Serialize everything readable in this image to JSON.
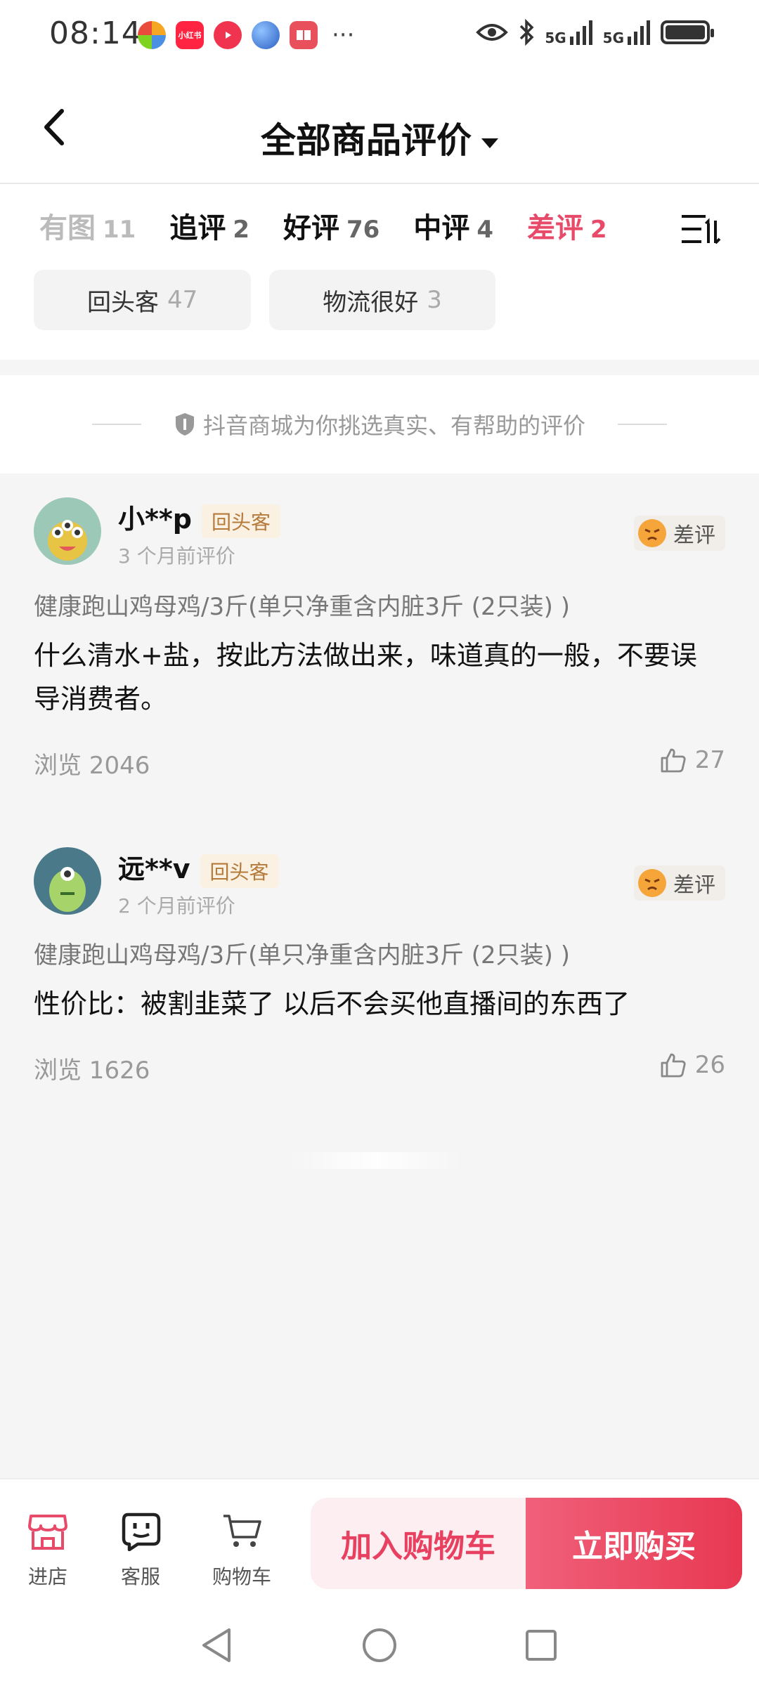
{
  "status_bar": {
    "time": "08:14",
    "apps": [
      {
        "icon": "app-pinwheel-icon",
        "color": "#4a90e2"
      },
      {
        "icon": "xiaohongshu-icon",
        "label": "小红书",
        "color": "#ff2442"
      },
      {
        "icon": "video-app-icon",
        "color": "#f0344f"
      },
      {
        "icon": "browser-app-icon",
        "color": "#3a7bd5"
      },
      {
        "icon": "reader-app-icon",
        "color": "#e8505b"
      }
    ],
    "more": "···",
    "network_1": "5G",
    "network_2": "5G"
  },
  "header": {
    "title": "全部商品评价"
  },
  "tabs": [
    {
      "label": "有图",
      "count": "11",
      "state": "faded"
    },
    {
      "label": "追评",
      "count": "2",
      "state": "normal"
    },
    {
      "label": "好评",
      "count": "76",
      "state": "normal"
    },
    {
      "label": "中评",
      "count": "4",
      "state": "normal"
    },
    {
      "label": "差评",
      "count": "2",
      "state": "active"
    }
  ],
  "chips": [
    {
      "label": "回头客",
      "count": "47"
    },
    {
      "label": "物流很好",
      "count": "3"
    }
  ],
  "notice": {
    "text": "抖音商城为你挑选真实、有帮助的评价"
  },
  "reviews": [
    {
      "nickname": "小**p",
      "badge": "回头客",
      "time": "3 个月前评价",
      "rating": "差评",
      "product": "健康跑山鸡母鸡/3斤(单只净重含内脏3斤 (2只装) )",
      "content": "什么清水+盐，按此方法做出来，味道真的一般，不要误导消费者。",
      "views": "浏览 2046",
      "likes": "27"
    },
    {
      "nickname": "远**v",
      "badge": "回头客",
      "time": "2 个月前评价",
      "rating": "差评",
      "product": "健康跑山鸡母鸡/3斤(单只净重含内脏3斤 (2只装) )",
      "content": "性价比：被割韭菜了 以后不会买他直播间的东西了",
      "views": "浏览 1626",
      "likes": "26"
    }
  ],
  "bottom_bar": {
    "shop": "进店",
    "service": "客服",
    "cart": "购物车",
    "add_to_cart": "加入购物车",
    "buy_now": "立即购买"
  },
  "colors": {
    "accent": "#e84a6a",
    "buy_button": "#e83852",
    "badge_text": "#b57a3a"
  }
}
